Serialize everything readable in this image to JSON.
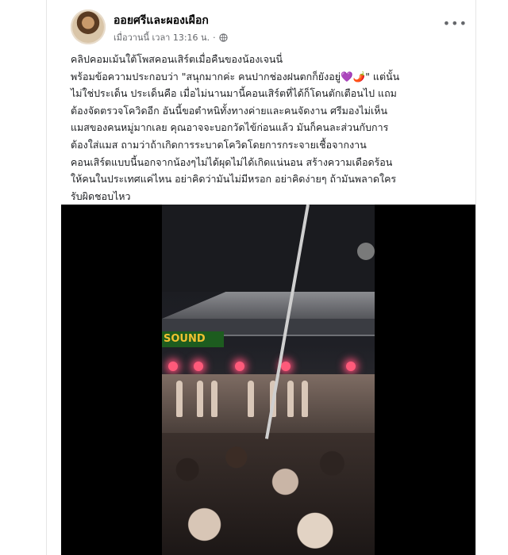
{
  "post": {
    "author": "ออยศรีและผองเผือก",
    "timestamp": "เมื่อวานนี้ เวลา 13:16 น.",
    "separator": "·",
    "more_label": "•••",
    "text_lines": [
      "คลิปคอมเม้นใต้โพสคอนเสิร์ตเมื่อคืนของน้องเจนนี่",
      "พร้อมข้อความประกอบว่า \"สนุกมากค่ะ คนปากช่องฝนตกก็ยังอยู่",
      "ไม่ใช่ประเด็น ประเด็นคือ เมื่อไม่นานมานี้คอนเสิร์ตที่ได้ก็โดนตักเตือนไป แถม",
      "ต้องจัดตรวจโควิดอีก อันนี้ขอตำหนิทั้งทางค่ายและคนจัดงาน ศรีมองไม่เห็น",
      "แมสของคนหมู่มากเลย คุณอาจจะบอกวัดไข้ก่อนแล้ว มันก็คนละส่วนกับการ",
      "ต้องใส่แมส ถามว่าถ้าเกิดการระบาดโควิดโดยการกระจายเชื้อจากงาน",
      "คอนเสิร์ตแบบนี้นอกจากน้องๆไม่ได้ผุดไม่ได้เกิดแน่นอน สร้างความเดือดร้อน",
      "ให้คนในประเทศแค่ไหน อย่าคิดว่ามันไม่มีหรอก อย่าคิดง่ายๆ ถ้ามันพลาดใคร",
      "รับผิดชอบไหว"
    ],
    "line2_emojis": "💜🌶️",
    "line2_tail": "\" แต่นั้น",
    "video_sign": "SOUND"
  },
  "colors": {
    "heart": "#8b3fd6",
    "chili": "#d0342c"
  }
}
